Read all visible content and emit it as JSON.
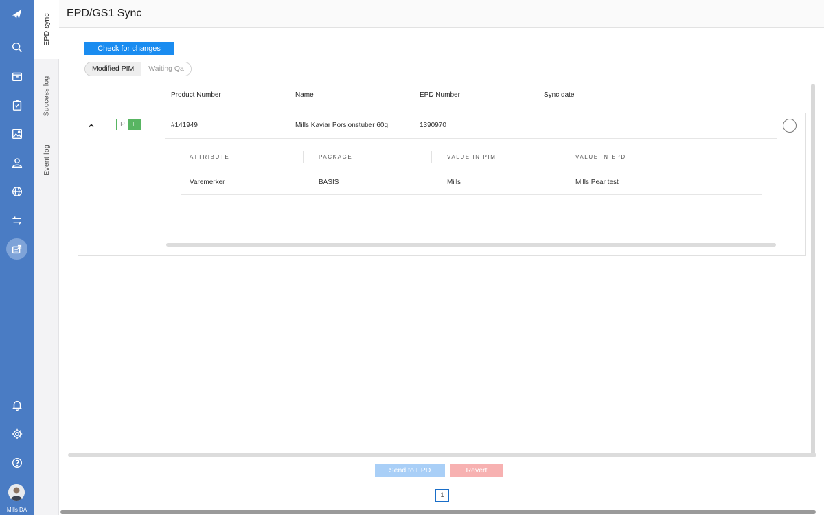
{
  "app": {
    "page_title": "EPD/GS1 Sync",
    "user_label": "Mills DA"
  },
  "nav_icons": [
    "logo-icon",
    "search-icon",
    "box-icon",
    "clipboard-check-icon",
    "image-icon",
    "user-icon",
    "globe-icon",
    "transfer-arrows-icon",
    "sync-export-icon",
    "bell-icon",
    "gear-icon",
    "help-icon"
  ],
  "tabs": [
    {
      "label": "EPD sync",
      "active": true
    },
    {
      "label": "Success log",
      "active": false
    },
    {
      "label": "Event log",
      "active": false
    }
  ],
  "toolbar": {
    "check_label": "Check for changes",
    "filters": [
      {
        "label": "Modified PIM",
        "active": true
      },
      {
        "label": "Waiting Qa",
        "active": false
      }
    ]
  },
  "table": {
    "columns": [
      "Product Number",
      "Name",
      "EPD Number",
      "Sync date"
    ],
    "rows": [
      {
        "badge_p": "P",
        "badge_l": "L",
        "product_number": "#141949",
        "name": "Mills Kaviar Porsjonstuber 60g",
        "epd_number": "1390970",
        "sync_date": "",
        "detail": {
          "columns": [
            "ATTRIBUTE",
            "PACKAGE",
            "VALUE IN PIM",
            "VALUE IN EPD"
          ],
          "rows": [
            {
              "attribute": "Varemerker",
              "package": "BASIS",
              "value_pim": "Mills",
              "value_epd": "Mills Pear test"
            }
          ]
        }
      }
    ]
  },
  "actions": {
    "send_label": "Send to EPD",
    "revert_label": "Revert"
  },
  "pagination": {
    "current": "1"
  },
  "colors": {
    "rail": "#4a7cc4",
    "primary": "#1a8cf0",
    "success": "#58b562",
    "danger_light": "#f7b1b1"
  }
}
